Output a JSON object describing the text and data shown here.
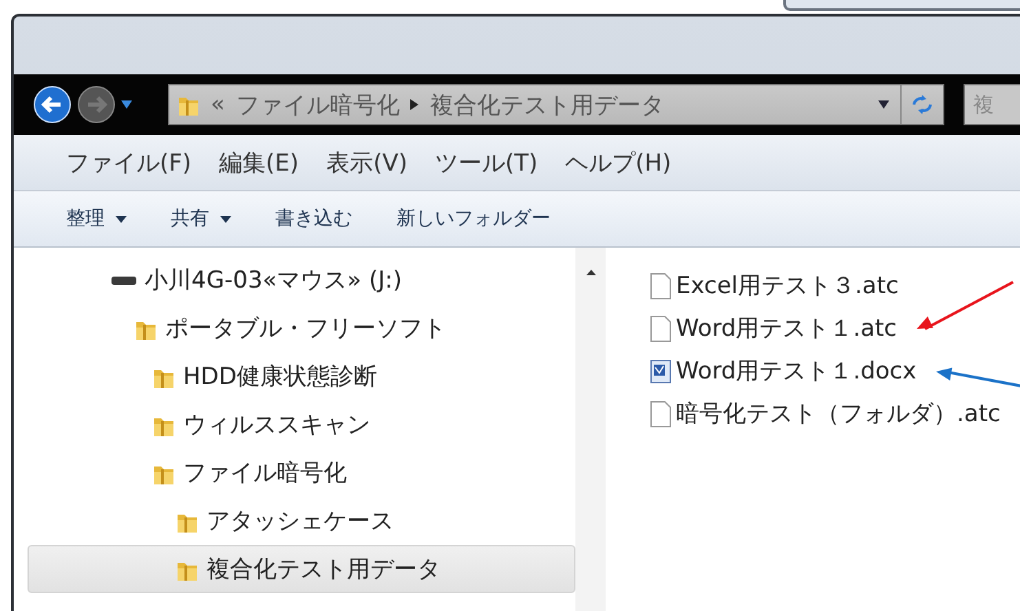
{
  "address_bar": {
    "overflow": "«",
    "path": [
      "ファイル暗号化",
      "複合化テスト用データ"
    ]
  },
  "search": {
    "placeholder": "複"
  },
  "menu": [
    "ファイル(F)",
    "編集(E)",
    "表示(V)",
    "ツール(T)",
    "ヘルプ(H)"
  ],
  "commands": [
    {
      "label": "整理",
      "dropdown": true
    },
    {
      "label": "共有",
      "dropdown": true
    },
    {
      "label": "書き込む",
      "dropdown": false
    },
    {
      "label": "新しいフォルダー",
      "dropdown": false
    }
  ],
  "nav_tree": [
    {
      "label": "小川4G-03«マウス» (J:)",
      "kind": "drive",
      "selected": false,
      "children": [
        {
          "label": "ポータブル・フリーソフト",
          "kind": "folder",
          "selected": false,
          "children": [
            {
              "label": "HDD健康状態診断",
              "kind": "folder",
              "selected": false
            },
            {
              "label": "ウィルススキャン",
              "kind": "folder",
              "selected": false
            },
            {
              "label": "ファイル暗号化",
              "kind": "folder",
              "selected": false,
              "children": [
                {
                  "label": "アタッシェケース",
                  "kind": "folder",
                  "selected": false
                },
                {
                  "label": "複合化テスト用データ",
                  "kind": "folder",
                  "selected": true
                }
              ]
            }
          ]
        }
      ]
    }
  ],
  "files": [
    {
      "name": "Excel用テスト３.atc",
      "kind": "blank"
    },
    {
      "name": "Word用テスト１.atc",
      "kind": "blank",
      "pointer": {
        "color": "#e8141c",
        "kind": "rising"
      }
    },
    {
      "name": "Word用テスト１.docx",
      "kind": "word",
      "pointer": {
        "color": "#1b72c8",
        "kind": "falling"
      }
    },
    {
      "name": "暗号化テスト（フォルダ）.atc",
      "kind": "blank"
    }
  ]
}
